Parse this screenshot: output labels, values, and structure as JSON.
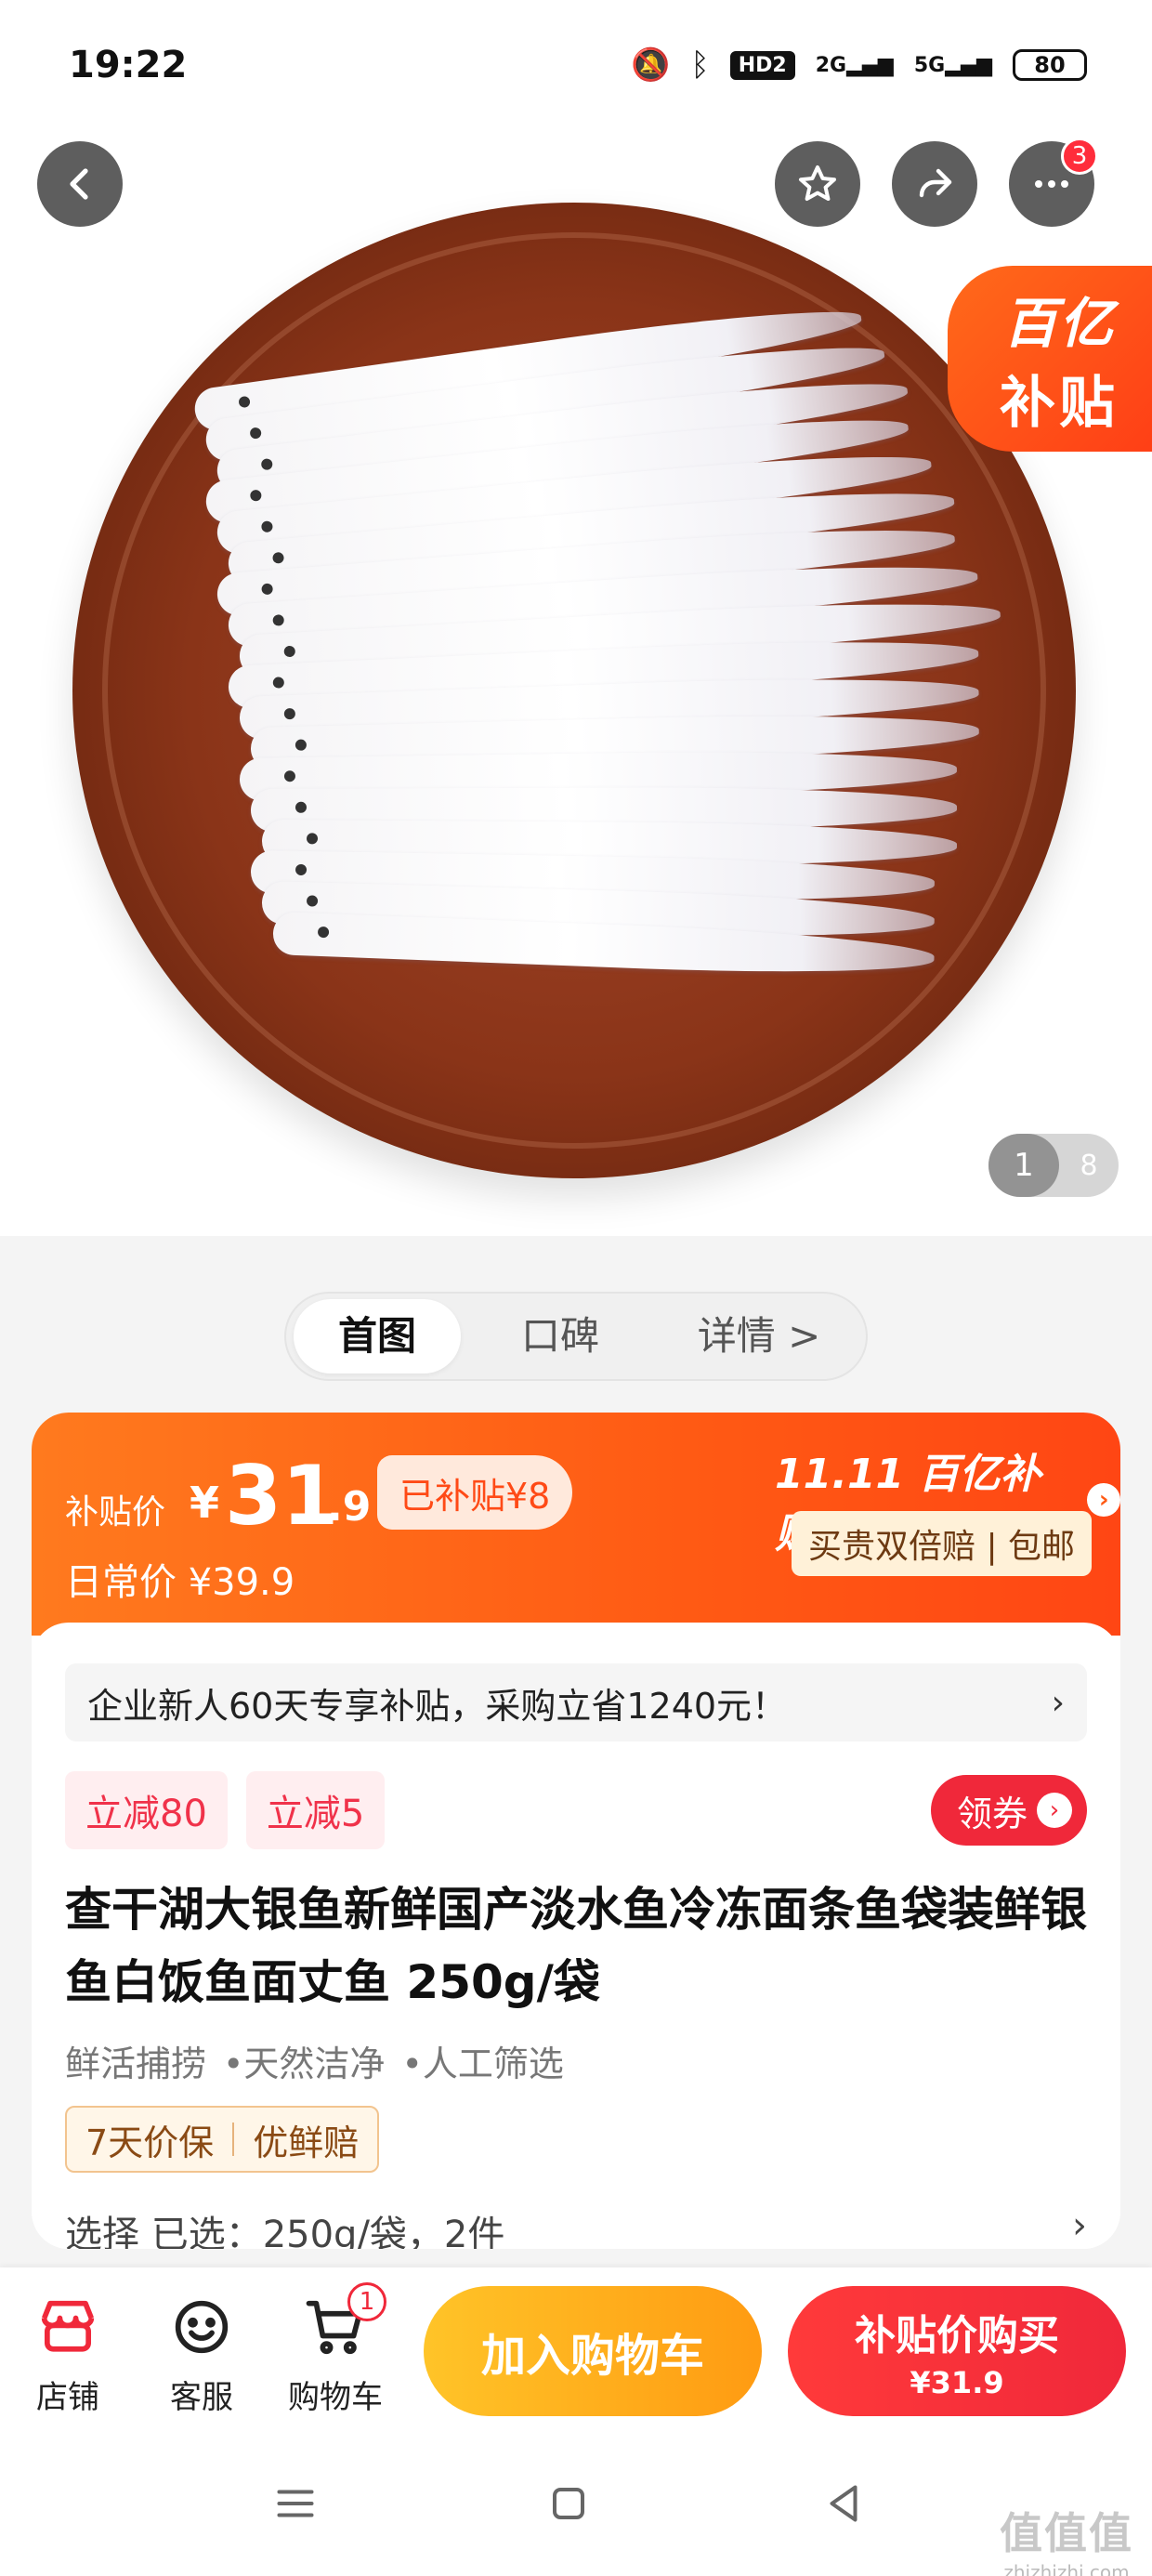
{
  "status_bar": {
    "time": "19:22",
    "network_hd": "HD2",
    "signal_1": "2G",
    "signal_2": "5G",
    "battery": "80"
  },
  "hero": {
    "subsidy_stamp_line1": "百亿",
    "subsidy_stamp_line2": "补贴",
    "pager_current": "1",
    "pager_total": "8",
    "more_badge": "3"
  },
  "tabs": [
    {
      "label": "首图",
      "active": true
    },
    {
      "label": "口碑",
      "active": false
    },
    {
      "label": "详情 >",
      "active": false
    }
  ],
  "price": {
    "label": "补贴价",
    "yen": "¥",
    "integer": "31",
    "decimal": ".9",
    "subsidized_tag": "已补贴¥8",
    "daily_price": "日常价 ¥39.9",
    "brand_logo": "11.11 百亿补贴",
    "brand_chevron": "›",
    "guarantee": "买贵双倍赔 | 包邮"
  },
  "promo": {
    "text": "企业新人60天专享补贴，采购立省1240元！",
    "arrow": "›"
  },
  "coupons": [
    "立减80",
    "立减5"
  ],
  "get_coupon_label": "领券",
  "get_coupon_icon": "›",
  "product": {
    "title": "查干湖大银鱼新鲜国产淡水鱼冷冻面条鱼袋装鲜银鱼白饭鱼面丈鱼 250g/袋",
    "features": [
      "鲜活捕捞",
      "•天然洁净",
      "•人工筛选"
    ],
    "service_tags": [
      "7天价保",
      "优鲜赔"
    ],
    "select_row_left": "选择   已选：250g/袋，2件",
    "select_row_right": "›"
  },
  "action_bar": {
    "store": "店铺",
    "service": "客服",
    "cart": "购物车",
    "cart_badge": "1",
    "add_to_cart": "加入购物车",
    "buy_label": "补贴价购买",
    "buy_price": "¥31.9"
  },
  "watermark": {
    "line1": "值值值",
    "line2": "zhizhizhi.com"
  },
  "colors": {
    "accent_orange": "#ff5a14",
    "accent_red": "#f0283a",
    "accent_yellow": "#ffc428"
  }
}
